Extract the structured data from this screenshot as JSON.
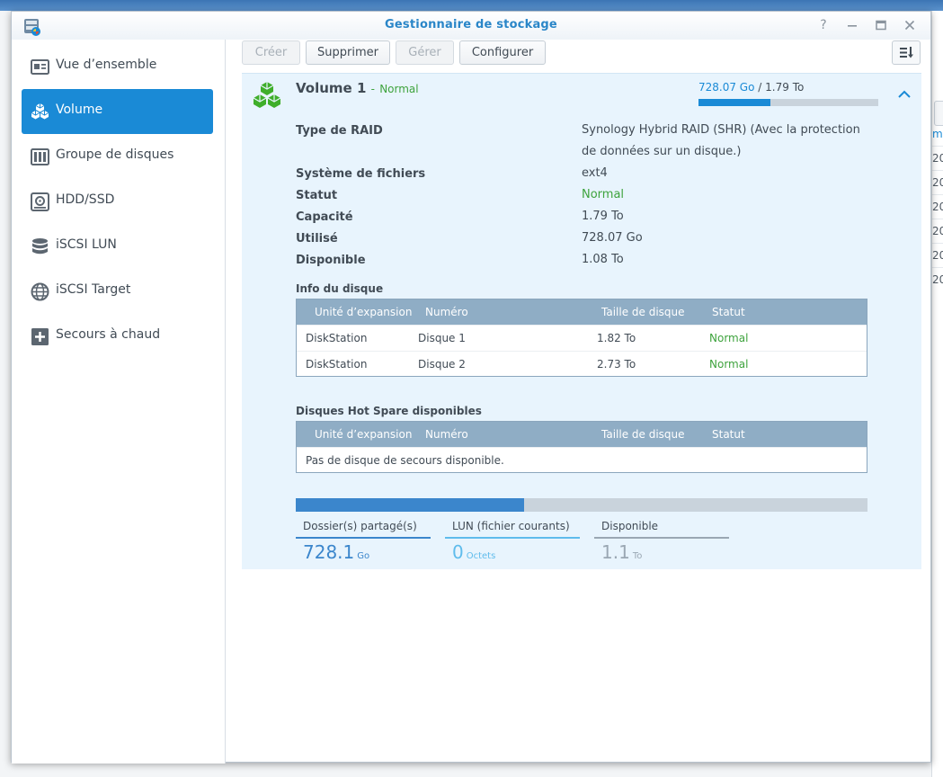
{
  "window": {
    "title": "Gestionnaire de stockage",
    "controls": [
      "help-icon",
      "minimize-icon",
      "maximize-icon",
      "close-icon"
    ]
  },
  "sidebar": {
    "items": [
      {
        "label": "Vue d’ensemble",
        "icon": "overview-icon",
        "active": false
      },
      {
        "label": "Volume",
        "icon": "volume-cubes-icon",
        "active": true
      },
      {
        "label": "Groupe de disques",
        "icon": "disk-group-icon",
        "active": false
      },
      {
        "label": "HDD/SSD",
        "icon": "hdd-icon",
        "active": false
      },
      {
        "label": "iSCSI LUN",
        "icon": "database-icon",
        "active": false
      },
      {
        "label": "iSCSI Target",
        "icon": "globe-icon",
        "active": false
      },
      {
        "label": "Secours à chaud",
        "icon": "hot-spare-plus-icon",
        "active": false
      }
    ]
  },
  "toolbar": {
    "create_label": "Créer",
    "delete_label": "Supprimer",
    "manage_label": "Gérer",
    "configure_label": "Configurer",
    "sort_icon": "sort-icon"
  },
  "volume": {
    "name": "Volume 1",
    "separator": "-",
    "status": "Normal",
    "used": "728.07 Go",
    "slash": "/",
    "total": "1.79 To",
    "usage_fraction": 0.4,
    "properties": [
      {
        "label": "Type de RAID",
        "value": "Synology Hybrid RAID (SHR) (Avec la protection de données sur un disque.)"
      },
      {
        "label": "Système de fichiers",
        "value": "ext4"
      },
      {
        "label": "Statut",
        "value": "Normal"
      },
      {
        "label": "Capacité",
        "value": "1.79 To"
      },
      {
        "label": "Utilisé",
        "value": "728.07 Go"
      },
      {
        "label": "Disponible",
        "value": "1.08 To"
      }
    ],
    "disk_info": {
      "title": "Info du disque",
      "columns": [
        "Unité d’expansion",
        "Numéro",
        "Taille de disque",
        "Statut"
      ],
      "rows": [
        [
          "DiskStation",
          "Disque 1",
          "1.82 To",
          "Normal"
        ],
        [
          "DiskStation",
          "Disque 2",
          "2.73 To",
          "Normal"
        ]
      ]
    },
    "hot_spare": {
      "title": "Disques Hot Spare disponibles",
      "columns": [
        "Unité d’expansion",
        "Numéro",
        "Taille de disque",
        "Statut"
      ],
      "empty_text": "Pas de disque de secours disponible."
    },
    "allocation": {
      "shared_fraction": 0.4,
      "legend": [
        {
          "label": "Dossier(s) partagé(s)",
          "value": "728.1",
          "unit": "Go",
          "color": "#3b86cc"
        },
        {
          "label": "LUN (fichier courants)",
          "value": "0",
          "unit": "Octets",
          "color": "#5fbcec"
        },
        {
          "label": "Disponible",
          "value": "1.1",
          "unit": "To",
          "color": "#9aa7b3"
        }
      ]
    }
  },
  "background_window": {
    "cells": [
      "m",
      "20",
      "20",
      "20",
      "20",
      "20",
      "20"
    ]
  },
  "colors": {
    "accent": "#1a8ad6",
    "status_green": "#3ea33d",
    "panel_bg": "#e8f4fd",
    "grid_header": "#8fadc5"
  }
}
